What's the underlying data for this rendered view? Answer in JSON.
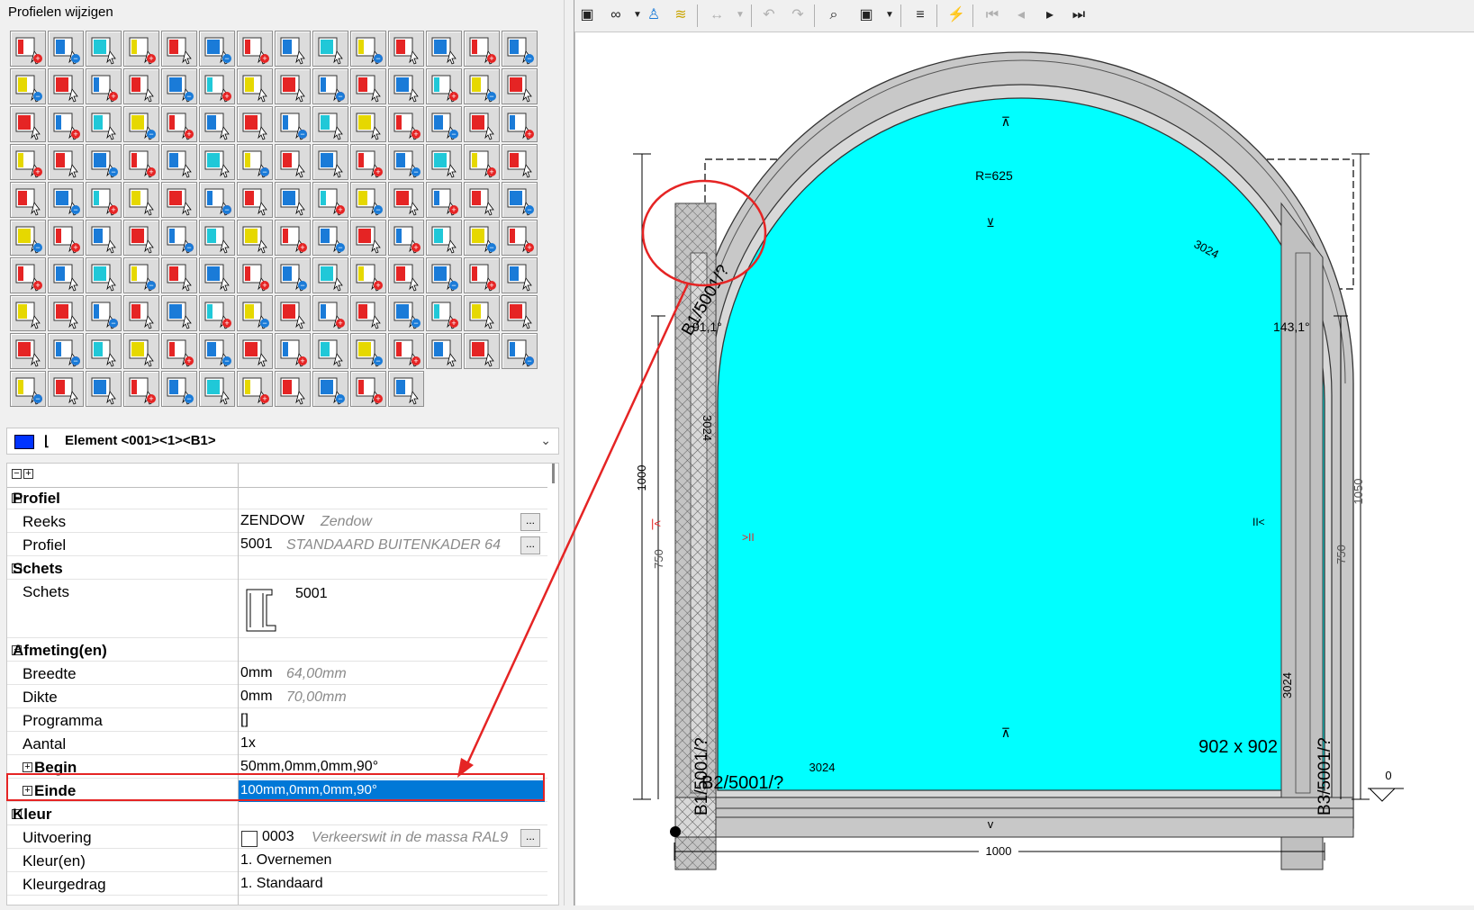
{
  "panel": {
    "title": "Profielen wijzigen"
  },
  "element_selector": {
    "label": "Element <001><1><B1>"
  },
  "properties": {
    "rows": [
      {
        "kind": "cat",
        "key": "Profiel"
      },
      {
        "kind": "prop",
        "key": "Reeks",
        "value": "ZENDOW",
        "hint": "Zendow",
        "button": "..."
      },
      {
        "kind": "prop",
        "key": "Profiel",
        "value": "5001",
        "hint": "STANDAARD BUITENKADER 64",
        "button": "..."
      },
      {
        "kind": "cat",
        "key": "Schets"
      },
      {
        "kind": "sketch",
        "key": "Schets",
        "value": "5001"
      },
      {
        "kind": "cat",
        "key": "Afmeting(en)"
      },
      {
        "kind": "prop",
        "key": "Breedte",
        "value": "0mm",
        "hint": "64,00mm"
      },
      {
        "kind": "prop",
        "key": "Dikte",
        "value": "0mm",
        "hint": "70,00mm"
      },
      {
        "kind": "prop",
        "key": "Programma",
        "value": "[]"
      },
      {
        "kind": "prop",
        "key": "Aantal",
        "value": "1x"
      },
      {
        "kind": "sub",
        "key": "Begin",
        "value": "50mm,0mm,0mm,90°"
      },
      {
        "kind": "sub",
        "key": "Einde",
        "value": "100mm,0mm,0mm,90°",
        "selected": true
      },
      {
        "kind": "cat",
        "key": "Kleur"
      },
      {
        "kind": "prop",
        "key": "Uitvoering",
        "value": "0003",
        "hint": "Verkeerswit in de massa RAL9",
        "button": "...",
        "swatch": true
      },
      {
        "kind": "prop",
        "key": "Kleur(en)",
        "value": "1. Overnemen"
      },
      {
        "kind": "prop",
        "key": "Kleurgedrag",
        "value": "1. Standaard"
      }
    ]
  },
  "drawing": {
    "radius_label": "R=625",
    "frame_label_left": "B1/5001/?",
    "frame_label_bottom": "B2/5001/?",
    "frame_label_right": "B3/5001/?",
    "frame_label_left_low": "B1/5001/?",
    "glass_label": "902 x 902",
    "angle_left": "91,1°",
    "angle_right": "143,1°",
    "dim_bottom": "1000",
    "dim_left_total": "1000",
    "dim_left_low": "750",
    "dim_right_total": "1050",
    "dim_right_low": "750",
    "len_top": "3024",
    "len_left": "3024",
    "len_right": "3024",
    "len_bottom": "3024",
    "elevation": "0",
    "colors": {
      "glass": "#00ffff",
      "frame": "#c8c8c8",
      "annot_red": "#e52424"
    }
  }
}
